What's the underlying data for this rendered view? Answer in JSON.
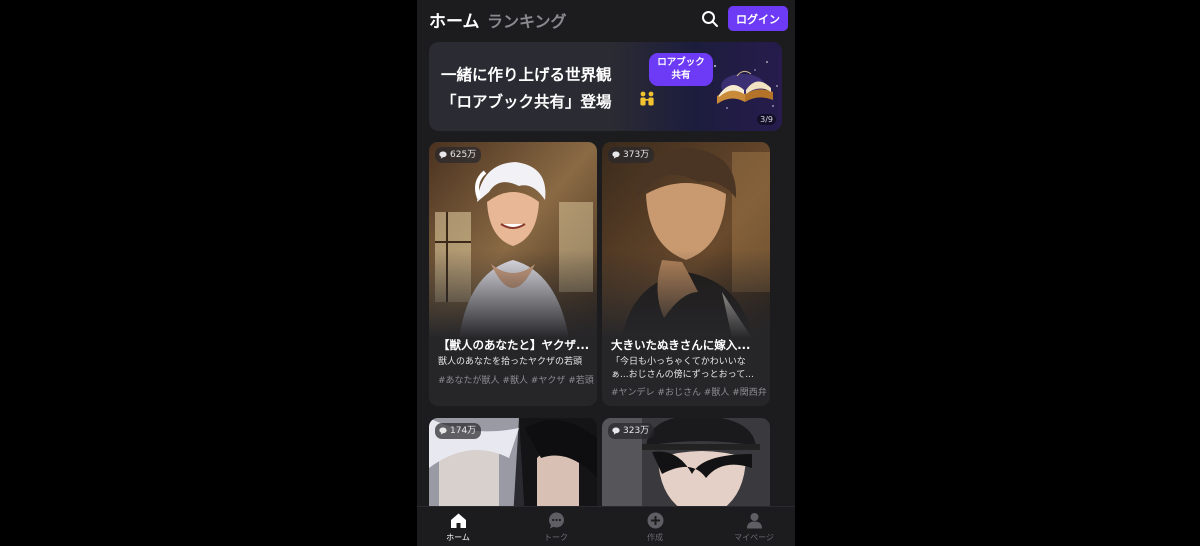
{
  "header": {
    "tabs": [
      "ホーム",
      "ランキング"
    ],
    "login_label": "ログイン"
  },
  "banner": {
    "line1": "一緒に作り上げる世界観",
    "line2": "「ロアブック共有」登場",
    "pill_line1": "ロアブック",
    "pill_line2": "共有",
    "counter": "3/9"
  },
  "cards": [
    {
      "count": "625万",
      "title": "【獣人のあなたと】ヤクザ...",
      "desc": "獣人のあなたを拾ったヤクザの若頭",
      "tags": "#あなたが獣人 #獣人 #ヤクザ #若頭"
    },
    {
      "count": "373万",
      "title": "大きいたぬきさんに嫁入...",
      "desc_line1": "「今日も小っちゃくてかわいいな",
      "desc_line2": "ぁ...おじさんの傍にずっとおって...",
      "tags": "#ヤンデレ #おじさん #獣人 #関西弁"
    },
    {
      "count": "174万"
    },
    {
      "count": "323万"
    }
  ],
  "nav": [
    {
      "label": "ホーム",
      "icon": "home-icon",
      "active": true
    },
    {
      "label": "トーク",
      "icon": "chat-icon",
      "active": false
    },
    {
      "label": "作成",
      "icon": "plus-circle-icon",
      "active": false
    },
    {
      "label": "マイページ",
      "icon": "user-icon",
      "active": false
    }
  ],
  "colors": {
    "accent": "#6d3bf5",
    "background": "#1c1c1f",
    "card": "#262629"
  }
}
